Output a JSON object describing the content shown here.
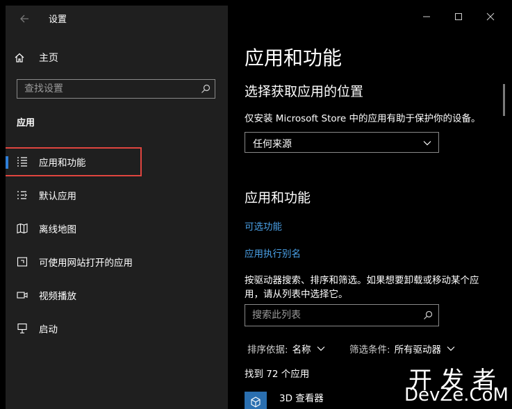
{
  "window": {
    "title": "设置"
  },
  "sidebar": {
    "home_label": "主页",
    "search_placeholder": "查找设置",
    "section_title": "应用",
    "items": [
      {
        "label": "应用和功能",
        "icon": "apps-list-icon",
        "active": true
      },
      {
        "label": "默认应用",
        "icon": "default-apps-icon",
        "active": false
      },
      {
        "label": "离线地图",
        "icon": "map-icon",
        "active": false
      },
      {
        "label": "可使用网站打开的应用",
        "icon": "web-apps-icon",
        "active": false
      },
      {
        "label": "视频播放",
        "icon": "video-icon",
        "active": false
      },
      {
        "label": "启动",
        "icon": "startup-icon",
        "active": false
      }
    ]
  },
  "main": {
    "page_title": "应用和功能",
    "install_section": {
      "heading": "选择获取应用的位置",
      "description": "仅安装 Microsoft Store 中的应用有助于保护你的设备。",
      "dropdown_value": "任何来源"
    },
    "apps_section": {
      "heading": "应用和功能",
      "link_optional": "可选功能",
      "link_alias": "应用执行别名",
      "description": "按驱动器搜索、排序和筛选。如果想要卸载或移动某个应用，请从列表中选择它。",
      "search_placeholder": "搜索此列表",
      "sort_label": "排序依据:",
      "sort_value": "名称",
      "filter_label": "筛选条件:",
      "filter_value": "所有驱动器",
      "count_text": "找到 72 个应用",
      "first_app": "3D 查看器"
    }
  },
  "watermark": {
    "line1": "开发者",
    "line2": "DevZe.CoM"
  },
  "colors": {
    "accent": "#2f7fd8",
    "link": "#4aa0e6",
    "highlight": "#e0453f",
    "sidebar_bg": "#1f1f1f",
    "main_bg": "#000000"
  }
}
